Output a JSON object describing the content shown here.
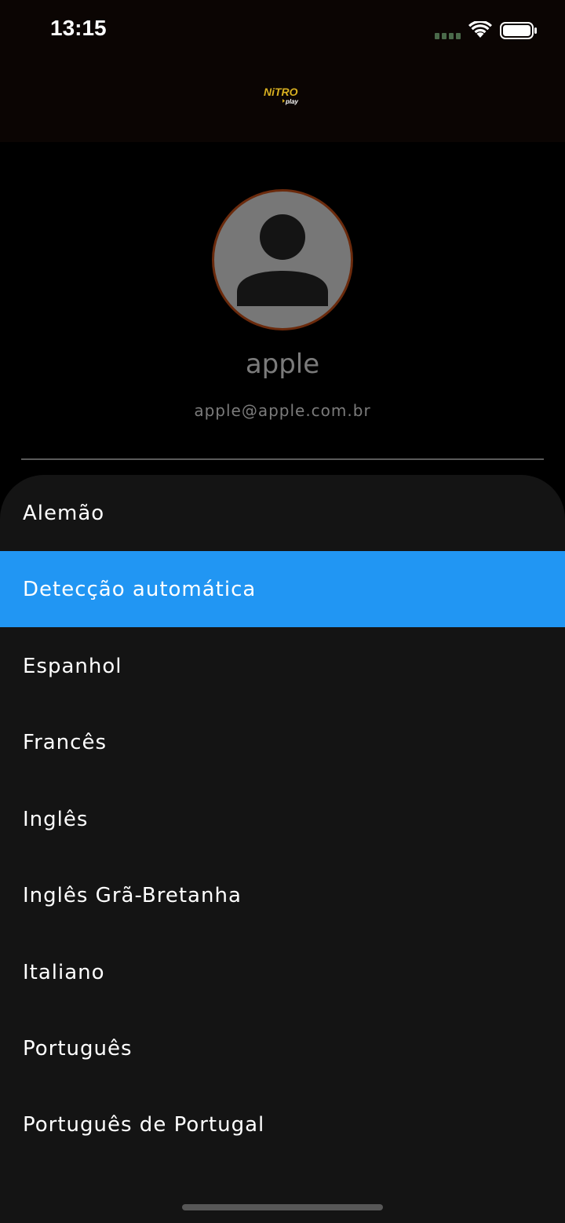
{
  "status_bar": {
    "time": "13:15",
    "icons": [
      "signal-icon",
      "wifi-icon",
      "battery-icon"
    ]
  },
  "header": {
    "logo_text": "NiTRO",
    "logo_subtext": "play",
    "logo_icon": "nitro-play-logo"
  },
  "profile": {
    "avatar_icon": "user-silhouette-icon",
    "name": "apple",
    "email": "apple@apple.com.br"
  },
  "language_sheet": {
    "selected_index": 1,
    "items": [
      {
        "label": "Alemão"
      },
      {
        "label": "Detecção automática"
      },
      {
        "label": "Espanhol"
      },
      {
        "label": "Francês"
      },
      {
        "label": "Inglês"
      },
      {
        "label": "Inglês Grã-Bretanha"
      },
      {
        "label": "Italiano"
      },
      {
        "label": "Português"
      },
      {
        "label": "Português de Portugal"
      }
    ]
  },
  "colors": {
    "accent_selected": "#2196f3",
    "avatar_border": "#6b2a0c",
    "sheet_background": "#141414",
    "header_background": "#0b0503"
  }
}
